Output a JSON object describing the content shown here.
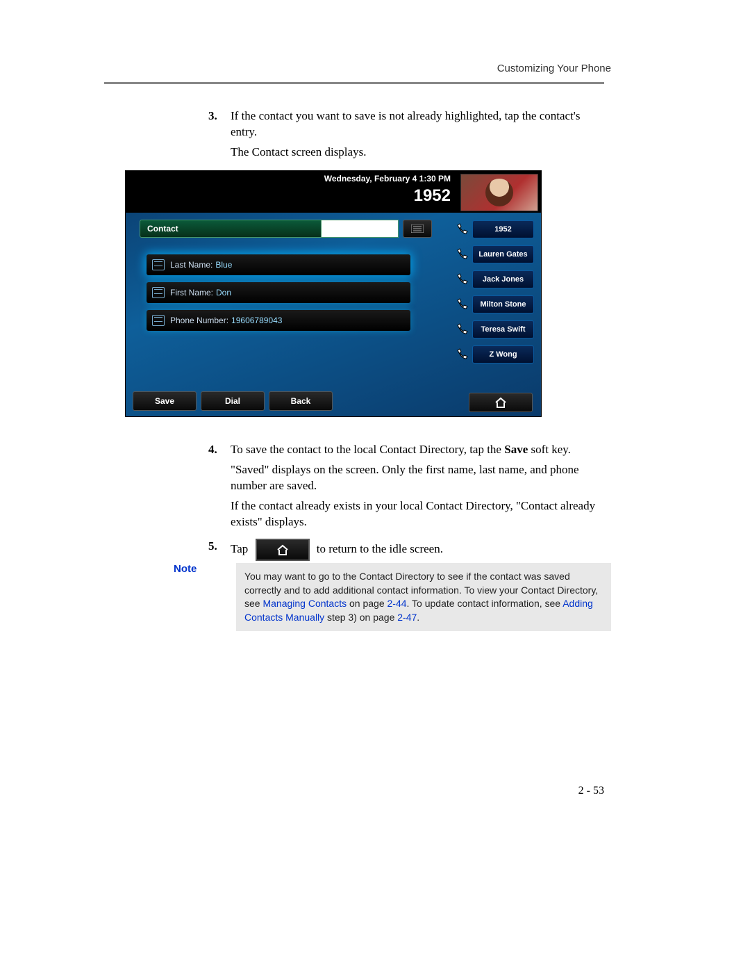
{
  "header": {
    "section_title": "Customizing Your Phone"
  },
  "steps": {
    "s3": {
      "num": "3.",
      "line1": "If the contact you want to save is not already highlighted, tap the contact's entry.",
      "line2": "The Contact screen displays."
    },
    "s4": {
      "num": "4.",
      "line1a": "To save the contact to the local Contact Directory, tap the ",
      "line1b": "Save",
      "line1c": " soft key.",
      "line2": "\"Saved\" displays on the screen. Only the first name, last name, and phone number are saved.",
      "line3": "If the contact already exists in your local Contact Directory, \"Contact already exists\" displays."
    },
    "s5": {
      "num": "5.",
      "before": "Tap",
      "after": "to return to the idle screen."
    }
  },
  "phone": {
    "datetime": "Wednesday, February 4  1:30 PM",
    "extension": "1952",
    "title": "Contact",
    "fields": {
      "lastname_label": "Last Name:",
      "lastname_value": "Blue",
      "firstname_label": "First Name:",
      "firstname_value": "Don",
      "phone_label": "Phone Number:",
      "phone_value": "19606789043"
    },
    "softkeys": {
      "save": "Save",
      "dial": "Dial",
      "back": "Back"
    },
    "sidelist": [
      "1952",
      "Lauren Gates",
      "Jack Jones",
      "Milton Stone",
      "Teresa Swift",
      "Z Wong"
    ]
  },
  "note": {
    "label": "Note",
    "t1": "You may want to go to the Contact Directory to see if the contact was saved correctly and to add additional contact information. To view your Contact Directory, see ",
    "link1": "Managing Contacts",
    "t2": " on page ",
    "pg1": "2-44",
    "t3": ". To update contact information, see ",
    "link2": "Adding Contacts Manually",
    "t4": " step 3) on page ",
    "pg2": "2-47",
    "t5": "."
  },
  "footer": {
    "page": "2 - 53"
  }
}
